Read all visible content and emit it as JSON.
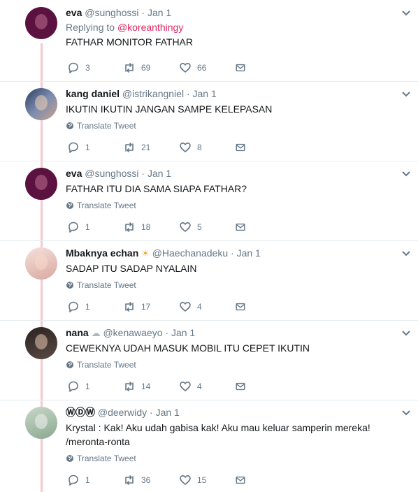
{
  "tweets": [
    {
      "name": "eva",
      "handle": "@sunghossi",
      "time": "Jan 1",
      "reply_label": "Replying to",
      "reply_to": "@koreanthingy",
      "text": "FATHAR MONITOR FATHAR",
      "translate": "",
      "replies": "3",
      "retweets": "69",
      "likes": "66",
      "avatar_color": "#6b1a4a"
    },
    {
      "name": "kang daniel",
      "handle": "@istrikangniel",
      "time": "Jan 1",
      "text": "IKUTIN IKUTIN JANGAN SAMPE KELEPASAN",
      "translate": "Translate Tweet",
      "replies": "1",
      "retweets": "21",
      "likes": "8",
      "avatar_color": "#4a5a78"
    },
    {
      "name": "eva",
      "handle": "@sunghossi",
      "time": "Jan 1",
      "text": "FATHAR ITU DIA SAMA SIAPA FATHAR?",
      "translate": "Translate Tweet",
      "replies": "1",
      "retweets": "18",
      "likes": "5",
      "avatar_color": "#6b1a4a"
    },
    {
      "name": "Mbaknya echan",
      "emoji": "☀️",
      "handle": "@Haechanadeku",
      "time": "Jan 1",
      "text": "SADAP ITU SADAP NYALAIN",
      "translate": "Translate Tweet",
      "replies": "1",
      "retweets": "17",
      "likes": "4",
      "avatar_color": "#e9c8c0"
    },
    {
      "name": "nana",
      "emoji": "🌥",
      "handle": "@kenawaeyo",
      "time": "Jan 1",
      "text": "CEWEKNYA UDAH MASUK MOBIL ITU CEPET IKUTIN",
      "translate": "Translate Tweet",
      "replies": "1",
      "retweets": "14",
      "likes": "4",
      "avatar_color": "#3b3030"
    },
    {
      "name": "ⓌⒹⓌ",
      "handle": "@deerwidy",
      "time": "Jan 1",
      "text": "Krystal : Kak! Aku udah gabisa kak! Aku mau keluar samperin mereka! /meronta-ronta",
      "translate": "Translate Tweet",
      "replies": "1",
      "retweets": "36",
      "likes": "15",
      "avatar_color": "#9fb8a0"
    }
  ],
  "colors": {
    "accent": "#e0245e",
    "muted": "#657786",
    "thread_line": "#f4c9cf"
  }
}
